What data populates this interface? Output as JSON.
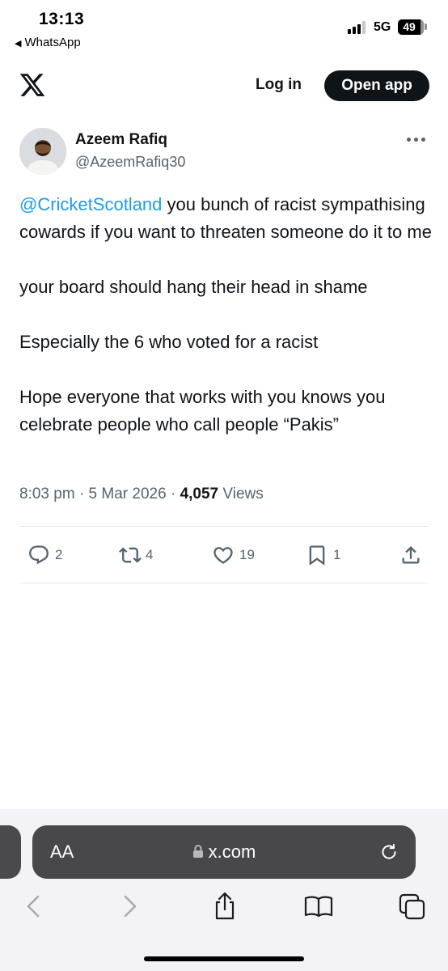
{
  "status_bar": {
    "time": "13:13",
    "back_app": "WhatsApp",
    "network": "5G",
    "battery_percent": "49"
  },
  "header": {
    "login_label": "Log in",
    "open_app_label": "Open app"
  },
  "tweet": {
    "author_name": "Azeem Rafiq",
    "author_handle": "@AzeemRafiq30",
    "mention": "@CricketScotland",
    "para1_rest": " you bunch of racist sympathising cowards if you want to threaten someone do it to me",
    "para2": "your board should hang their head in shame",
    "para3": "Especially the 6 who voted for a racist",
    "para4": "Hope everyone that works with you knows you celebrate people who call people “Pakis”",
    "time": "8:03 pm",
    "date": "5 Mar 2026",
    "views_count": "4,057",
    "views_label": "Views",
    "reply_count": "2",
    "retweet_count": "4",
    "like_count": "19",
    "bookmark_count": "1"
  },
  "browser": {
    "aa_label": "AA",
    "url": "x.com"
  },
  "colors": {
    "link": "#1d9bf0",
    "text": "#0f1419",
    "secondary": "#536471",
    "address_bar": "#48484c"
  }
}
